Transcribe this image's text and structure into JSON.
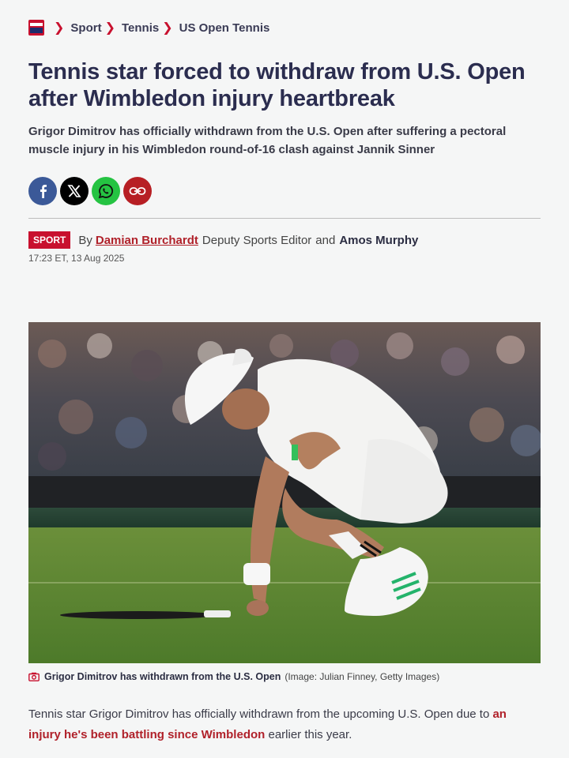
{
  "breadcrumb": {
    "logo": "mirror-logo",
    "items": [
      "Sport",
      "Tennis",
      "US Open Tennis"
    ]
  },
  "article": {
    "headline": "Tennis star forced to withdraw from U.S. Open after Wimbledon injury heartbreak",
    "standfirst": "Grigor Dimitrov has officially withdrawn from the U.S. Open after suffering a pectoral muscle injury in his Wimbledon round-of-16 clash against Jannik Sinner",
    "tag": "SPORT",
    "by": "By",
    "author1": "Damian Burchardt",
    "author1_role": "Deputy Sports Editor",
    "and": "and",
    "author2": "Amos Murphy",
    "timestamp": "17:23 ET, 13 Aug 2025",
    "image_caption": "Grigor Dimitrov has withdrawn from the U.S. Open",
    "image_credit": "(Image: Julian Finney, Getty Images)",
    "body_before": "Tennis star Grigor Dimitrov has officially withdrawn from the upcoming U.S. Open due to ",
    "body_link": "an injury he's been battling since Wimbledon",
    "body_after": " earlier this year."
  },
  "share": [
    "facebook-icon",
    "x-icon",
    "whatsapp-icon",
    "link-icon"
  ],
  "colors": {
    "accent": "#c8102e",
    "link": "#b0212a",
    "facebook": "#3b5998",
    "x": "#000000",
    "whatsapp": "#25c342",
    "copy_link": "#b71f24"
  }
}
